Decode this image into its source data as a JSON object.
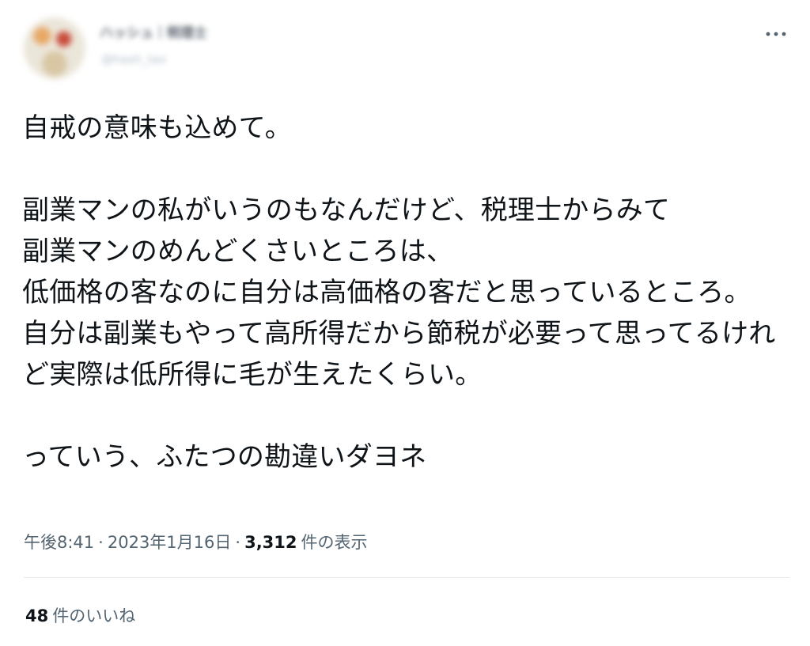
{
  "tweet": {
    "author": {
      "display_name": "ハッシュ｜税理士",
      "username": "@hash_tax"
    },
    "more_label": "…",
    "body": "自戒の意味も込めて。\n\n副業マンの私がいうのもなんだけど、税理士からみて\n副業マンのめんどくさいところは、\n低価格の客なのに自分は高価格の客だと思っているところ。\n自分は副業もやって高所得だから節税が必要って思ってるけれど実際は低所得に毛が生えたくらい。\n\nっていう、ふたつの勘違いダヨネ",
    "meta": {
      "time": "午後8:41",
      "separator": "·",
      "date": "2023年1月16日",
      "views_count": "3,312",
      "views_label": "件の表示"
    },
    "likes": {
      "count": "48",
      "label": "件のいいね"
    },
    "colors": {
      "text": "#0f1419",
      "secondary_text": "#536471",
      "divider": "#e7ebee",
      "background": "#ffffff"
    }
  }
}
